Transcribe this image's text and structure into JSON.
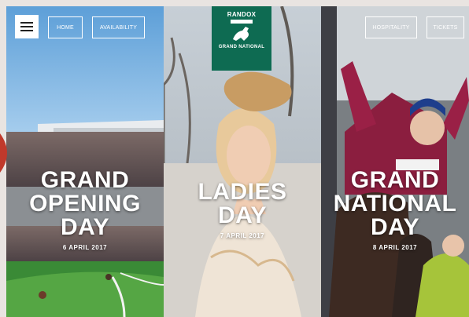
{
  "nav": {
    "menu_icon": "hamburger-menu-icon",
    "left": [
      "HOME",
      "AVAILABILITY"
    ],
    "right": [
      "HOSPITALITY",
      "TICKETS"
    ]
  },
  "logo": {
    "brand": "RANDOX",
    "name": "GRAND NATIONAL"
  },
  "panels": [
    {
      "title": [
        "GRAND",
        "OPENING",
        "DAY"
      ],
      "date": "6 APRIL 2017"
    },
    {
      "title": [
        "LADIES",
        "DAY"
      ],
      "date": "7 APRIL 2017"
    },
    {
      "title": [
        "GRAND",
        "NATIONAL",
        "DAY"
      ],
      "date": "8 APRIL 2017"
    }
  ],
  "colors": {
    "brand_green": "#0e6b52",
    "accent_red": "#c0392b"
  }
}
